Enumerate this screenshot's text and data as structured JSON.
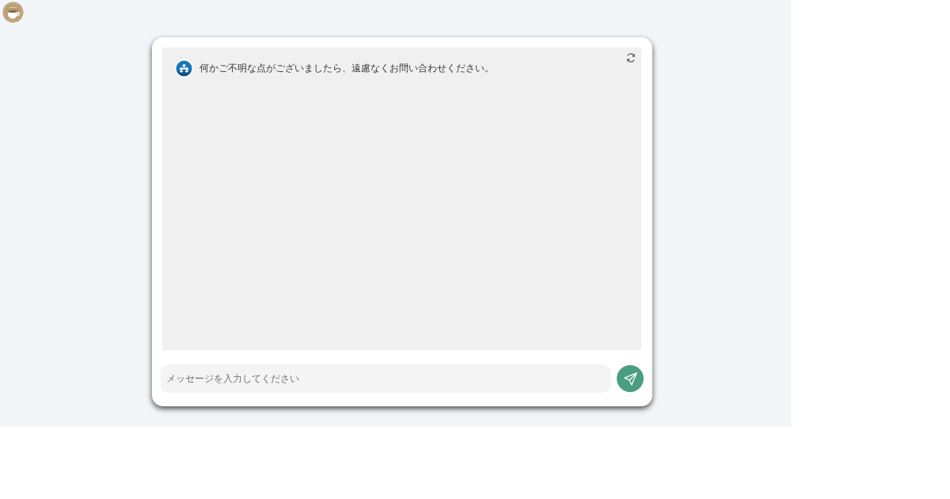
{
  "chat": {
    "messages": [
      {
        "kind": "bot",
        "text": "何かご不明な点がございましたら、遠慮なくお問い合わせください。"
      }
    ],
    "input": {
      "placeholder": "メッセージを入力してください"
    }
  }
}
